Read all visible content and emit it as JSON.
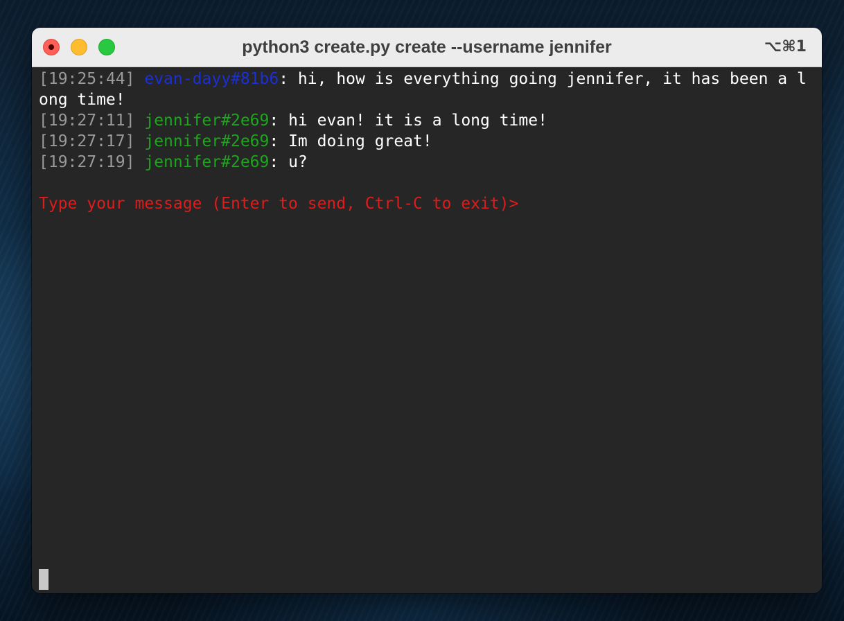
{
  "window": {
    "title": "python3 create.py create --username jennifer",
    "shortcut": "⌥⌘1"
  },
  "terminal": {
    "messages": [
      {
        "timestamp": "[19:25:44]",
        "user": "evan-dayy#81b6",
        "separator": ":",
        "text": " hi, how is everything going jennifer, it has been a long time!"
      },
      {
        "timestamp": "[19:27:11]",
        "user": "jennifer#2e69",
        "separator": ":",
        "text": " hi evan! it is a long time!"
      },
      {
        "timestamp": "[19:27:17]",
        "user": "jennifer#2e69",
        "separator": ":",
        "text": " Im doing great!"
      },
      {
        "timestamp": "[19:27:19]",
        "user": "jennifer#2e69",
        "separator": ":",
        "text": " u?"
      }
    ],
    "prompt": "Type your message (Enter to send, Ctrl-C to exit)>"
  },
  "colors": {
    "timestamp": "#9a9a9a",
    "user_evan": "#1a2fd6",
    "user_jennifer": "#1ea51e",
    "prompt": "#e01b1b",
    "terminal_bg": "#262626"
  },
  "icons": [
    "close-icon",
    "minimize-icon",
    "zoom-icon",
    "text-cursor-icon"
  ]
}
